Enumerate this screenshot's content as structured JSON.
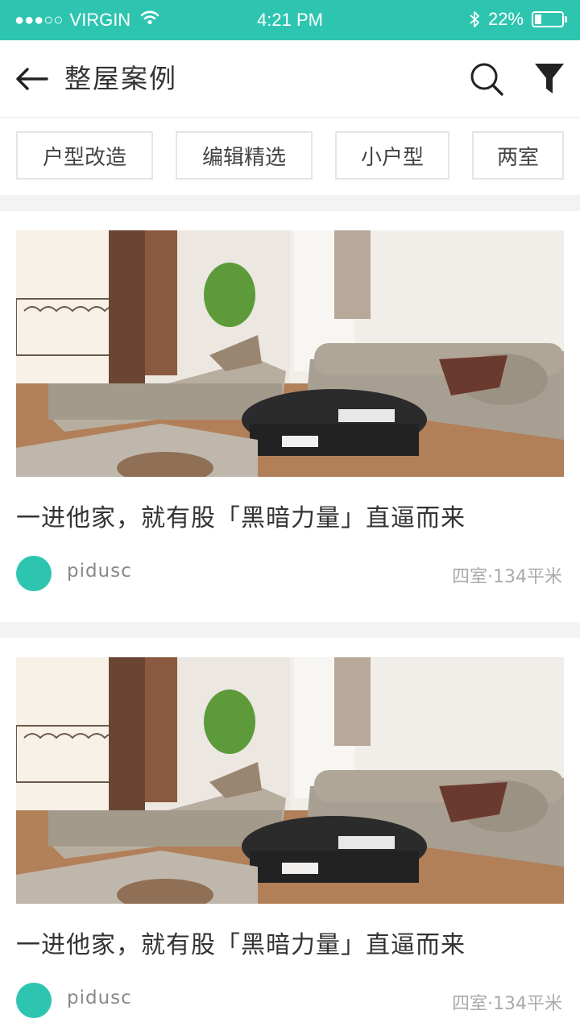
{
  "status_bar": {
    "signal_dots": "●●●○○",
    "carrier": "VIRGIN",
    "time": "4:21 PM",
    "battery_text": "22%",
    "battery_level": 0.22,
    "icons": [
      "wifi-icon",
      "bluetooth-icon",
      "battery-icon"
    ]
  },
  "header": {
    "title": "整屋案例",
    "icons": [
      "back-arrow-icon",
      "search-icon",
      "filter-icon"
    ]
  },
  "tags": [
    "户型改造",
    "编辑精选",
    "小户型",
    "两室"
  ],
  "cards": [
    {
      "title": "一进他家，就有股「黑暗力量」直逼而来",
      "author": "pidusc",
      "meta": "四室·134平米"
    },
    {
      "title": "一进他家，就有股「黑暗力量」直逼而来",
      "author": "pidusc",
      "meta": "四室·134平米"
    }
  ],
  "colors": {
    "accent": "#2ec5b0",
    "separator": "#f3f3f3",
    "tag_border": "#e5e5e5"
  }
}
